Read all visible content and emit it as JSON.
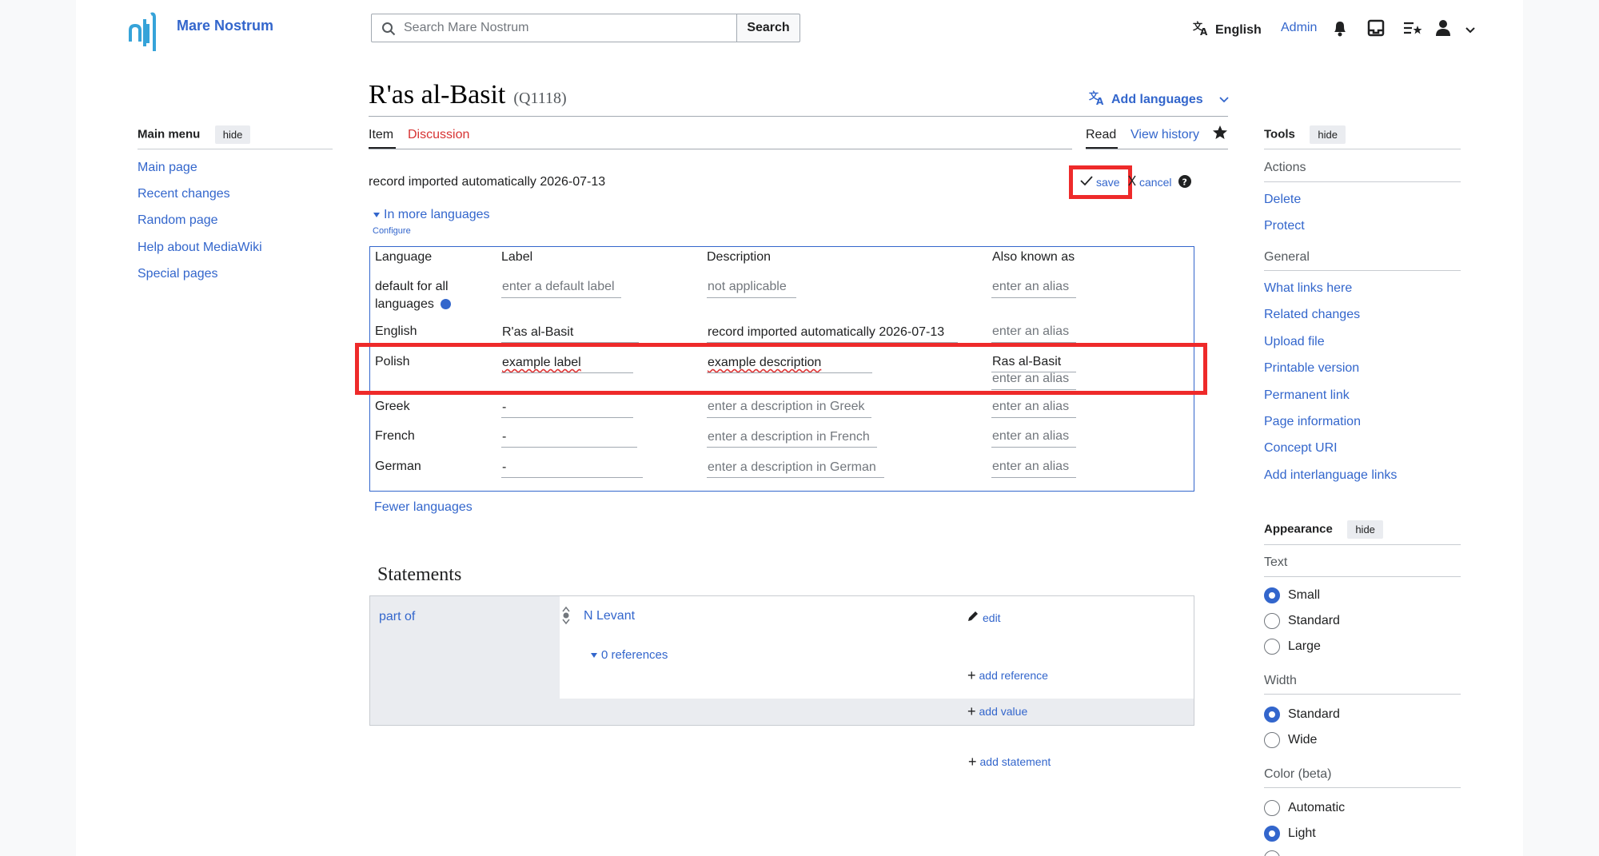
{
  "site": {
    "name": "Mare Nostrum",
    "logo_icon": "mare-nostrum-logo"
  },
  "search": {
    "placeholder": "Search Mare Nostrum",
    "button": "Search"
  },
  "user_menu": {
    "language": "English",
    "user": "Admin",
    "icons": [
      "language-icon",
      "bell-icon",
      "tray-icon",
      "watchlist-icon",
      "user-icon",
      "chevron-down-icon"
    ]
  },
  "main_menu": {
    "title": "Main menu",
    "hide": "hide",
    "items": [
      "Main page",
      "Recent changes",
      "Random page",
      "Help about MediaWiki",
      "Special pages"
    ]
  },
  "page": {
    "title": "R'as al-Basit",
    "qid": "(Q1118)",
    "add_languages": "Add languages",
    "tabs": {
      "item": "Item",
      "discussion": "Discussion",
      "read": "Read",
      "history": "View history"
    }
  },
  "edit_bar": {
    "summary": "record imported automatically 2026-07-13",
    "save": "save",
    "cancel": "cancel"
  },
  "more_languages": {
    "toggle": "In more languages",
    "configure": "Configure",
    "fewer": "Fewer languages"
  },
  "term_table": {
    "headers": [
      "Language",
      "Label",
      "Description",
      "Also known as"
    ],
    "rows": [
      {
        "lang": "default for all languages",
        "lang_line1": "default for all",
        "lang_line2": "languages",
        "label": "enter a default label",
        "description": "not applicable",
        "alias": "enter an alias"
      },
      {
        "lang": "English",
        "label": "R'as al-Basit",
        "description": "record imported automatically 2026-07-13",
        "alias": "enter an alias"
      },
      {
        "lang": "Polish",
        "label": "example label",
        "description": "example description",
        "alias": "Ras al-Basit",
        "alias_placeholder": "enter an alias"
      },
      {
        "lang": "Greek",
        "label": "-",
        "description": "enter a description in Greek",
        "alias": "enter an alias"
      },
      {
        "lang": "French",
        "label": "-",
        "description": "enter a description in French",
        "alias": "enter an alias"
      },
      {
        "lang": "German",
        "label": "-",
        "description": "enter a description in German",
        "alias": "enter an alias"
      }
    ]
  },
  "statements": {
    "title": "Statements",
    "property": "part of",
    "value": "N Levant",
    "edit": "edit",
    "references": "0 references",
    "add_reference": "add reference",
    "add_value": "add value",
    "add_statement": "add statement"
  },
  "tools": {
    "title": "Tools",
    "hide": "hide",
    "actions_title": "Actions",
    "actions": [
      "Delete",
      "Protect"
    ],
    "general_title": "General",
    "general": [
      "What links here",
      "Related changes",
      "Upload file",
      "Printable version",
      "Permanent link",
      "Page information",
      "Concept URI",
      "Add interlanguage links"
    ]
  },
  "appearance": {
    "title": "Appearance",
    "hide": "hide",
    "text_title": "Text",
    "text_options": [
      "Small",
      "Standard",
      "Large"
    ],
    "text_selected": "Small",
    "width_title": "Width",
    "width_options": [
      "Standard",
      "Wide"
    ],
    "width_selected": "Standard",
    "color_title": "Color (beta)",
    "color_options": [
      "Automatic",
      "Light"
    ],
    "color_selected": "Light"
  },
  "colors": {
    "link": "#3366cc",
    "highlight": "#ee2a2a",
    "border": "#a2a9b1"
  }
}
